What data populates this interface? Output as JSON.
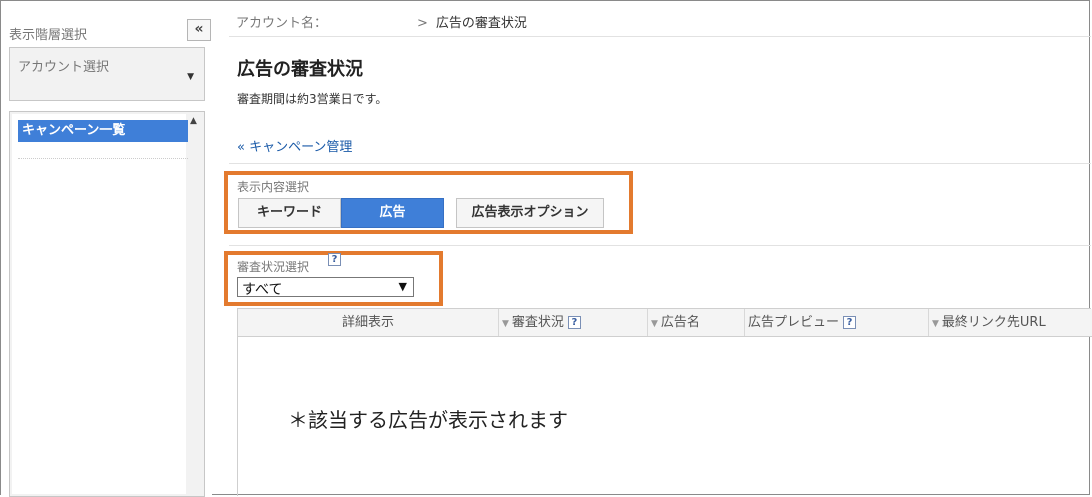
{
  "sidebar": {
    "title": "表示階層選択",
    "collapse_label": "«",
    "account_select_placeholder": "アカウント選択",
    "account_select_arrow": "▼",
    "selected_item": "キャンペーン一覧",
    "scroll_up": "▲"
  },
  "breadcrumb": {
    "account_label": "アカウント名：",
    "separator": ">",
    "current": "広告の審査状況"
  },
  "page": {
    "title": "広告の審査状況",
    "subtitle": "審査期間は約3営業日です。",
    "back_link": "« キャンペーン管理"
  },
  "display_selector": {
    "label": "表示内容選択",
    "tabs": [
      {
        "label": "キーワード",
        "active": false
      },
      {
        "label": "広告",
        "active": true
      },
      {
        "label": "広告表示オプション",
        "active": false
      }
    ]
  },
  "review_selector": {
    "label": "審査状況選択",
    "help": "?",
    "selected": "すべて",
    "arrow": "▼"
  },
  "table": {
    "columns": [
      {
        "label": "詳細表示",
        "sortable": false,
        "help": false
      },
      {
        "label": "審査状況",
        "sortable": true,
        "help": true
      },
      {
        "label": "広告名",
        "sortable": true,
        "help": false
      },
      {
        "label": "広告プレビュー",
        "sortable": false,
        "help": true
      },
      {
        "label": "最終リンク先URL",
        "sortable": true,
        "help": false
      }
    ],
    "sort_glyph": "▼",
    "help_glyph": "?"
  },
  "note": "＊該当する広告が表示されます",
  "colors": {
    "accent_blue": "#3f7fd8",
    "highlight_orange": "#e37a2e",
    "link_blue": "#1a5aa8"
  }
}
